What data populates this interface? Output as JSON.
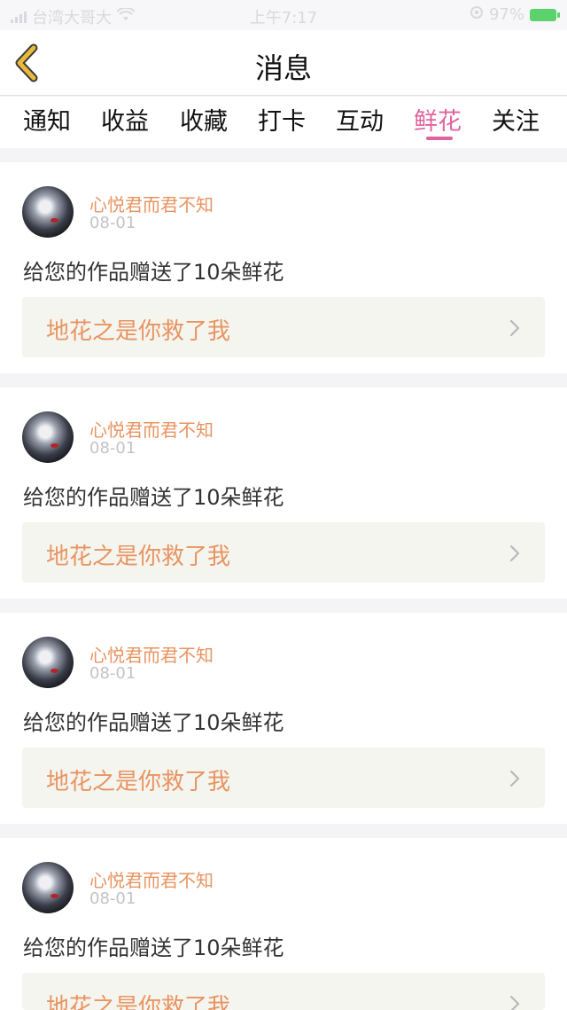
{
  "status_bar": {
    "carrier": "台湾大哥大",
    "time": "上午7:17",
    "battery": "97%"
  },
  "header": {
    "title": "消息"
  },
  "tabs": [
    {
      "label": "通知"
    },
    {
      "label": "收益"
    },
    {
      "label": "收藏"
    },
    {
      "label": "打卡"
    },
    {
      "label": "互动"
    },
    {
      "label": "鲜花",
      "active": true
    },
    {
      "label": "关注"
    }
  ],
  "messages": [
    {
      "user": "心悦君而君不知",
      "date": "08-01",
      "text": "给您的作品赠送了10朵鲜花",
      "work": "地花之是你救了我"
    },
    {
      "user": "心悦君而君不知",
      "date": "08-01",
      "text": "给您的作品赠送了10朵鲜花",
      "work": "地花之是你救了我"
    },
    {
      "user": "心悦君而君不知",
      "date": "08-01",
      "text": "给您的作品赠送了10朵鲜花",
      "work": "地花之是你救了我"
    },
    {
      "user": "心悦君而君不知",
      "date": "08-01",
      "text": "给您的作品赠送了10朵鲜花",
      "work": "地花之是你救了我"
    }
  ],
  "colors": {
    "accent_active_tab": "#e0639e",
    "username": "#e89461",
    "back_arrow": "#e8b93a"
  }
}
